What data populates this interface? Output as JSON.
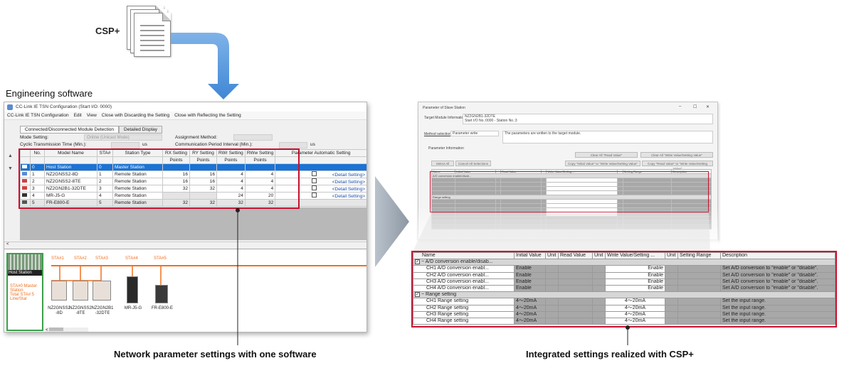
{
  "csp_label": "CSP+",
  "engineering_label": "Engineering software",
  "caption_left": "Network parameter settings with one software",
  "caption_right": "Integrated settings realized with CSP+",
  "eng_window": {
    "title": "CC-Link IE TSN Configuration (Start I/O: 0000)",
    "menu": [
      "CC-Link IE TSN Configuration",
      "Edit",
      "View",
      "Close with Discarding the Setting",
      "Close with Reflecting the Setting"
    ],
    "tabs": [
      "Connected/Disconnected Module Detection",
      "Detailed Display"
    ],
    "mode_label": "Mode Setting:",
    "mode_value": "Online (Unicast Mode)",
    "assign_label": "Assignment Method:",
    "cyclic_label": "Cyclic Transmission Time (Min.):",
    "cyclic_unit": "us",
    "comm_label": "Communication Period Interval (Min.):",
    "comm_unit": "us",
    "headers": [
      "No.",
      "Model Name",
      "STA#",
      "Station Type",
      "RX Setting",
      "RY Setting",
      "RWr Setting",
      "RWw Setting",
      "Parameter Automatic Setting"
    ],
    "subheader": "Points",
    "rows": [
      {
        "no": "0",
        "model": "Host Station",
        "sta": "0",
        "type": "Master Station",
        "rx": "",
        "ry": "",
        "rwr": "",
        "rww": "",
        "detail": ""
      },
      {
        "no": "1",
        "model": "NZ2GNSS2-8D",
        "sta": "1",
        "type": "Remote Station",
        "rx": "16",
        "ry": "16",
        "rwr": "4",
        "rww": "4",
        "detail": "<Detail Setting>"
      },
      {
        "no": "2",
        "model": "NZ2GNSS2-8TE",
        "sta": "2",
        "type": "Remote Station",
        "rx": "16",
        "ry": "16",
        "rwr": "4",
        "rww": "4",
        "detail": "<Detail Setting>"
      },
      {
        "no": "3",
        "model": "NZ2GN2B1-32DTE",
        "sta": "3",
        "type": "Remote Station",
        "rx": "32",
        "ry": "32",
        "rwr": "4",
        "rww": "4",
        "detail": "<Detail Setting>"
      },
      {
        "no": "4",
        "model": "MR-J5-G",
        "sta": "4",
        "type": "Remote Station",
        "rx": "",
        "ry": "",
        "rwr": "24",
        "rww": "20",
        "detail": "<Detail Setting>"
      },
      {
        "no": "5",
        "model": "FR-E800-E",
        "sta": "5",
        "type": "Remote Station",
        "rx": "32",
        "ry": "32",
        "rwr": "32",
        "rww": "32",
        "detail": ""
      }
    ],
    "topology": {
      "sta_labels": [
        "STA#1",
        "STA#2",
        "STA#3",
        "STA#4",
        "STA#5"
      ],
      "host_title": "Host Station",
      "host_info": [
        "STA#0  Master",
        "Station",
        "Total STA#:5",
        "Line/Star"
      ],
      "devices": [
        "NZ2GNSS2\n-8D",
        "NZ2GNSS2\n-8TE",
        "NZ2GN2B1\n-32DTE",
        "MR-J5-G",
        "FR-E800-E"
      ]
    }
  },
  "param_window": {
    "title": "Parameter of Slave Station",
    "target_label": "Target Module Information:",
    "target_value": "NZ2GN2B1-32DTE",
    "target_value2": "Start I/O No.:0000 - Station No.:3",
    "method_label": "Method selection:",
    "method_value": "Parameter write",
    "method_desc": "The parameters are written to the target module.",
    "info_label": "Parameter Information",
    "buttons": [
      "Select All",
      "Cancel All Selections",
      "Clear All \"Read Value\"",
      "Clear All \"Write Value/Setting Value\"",
      "Copy \"Initial Value\" to \"Write Value/Setting Value\"",
      "Copy \"Read Value\" to \"Write Value/Setting Value\""
    ]
  },
  "zoom_table": {
    "headers": [
      "Name",
      "Initial Value",
      "Unit",
      "Read Value",
      "Unit",
      "Write Value/Setting ...",
      "Unit",
      "Setting Range",
      "Description"
    ],
    "groups": [
      {
        "name": "A/D conversion enable/disab...",
        "rows": [
          {
            "name": "CH1 A/D conversion enabl...",
            "initial": "Enable",
            "write": "Enable",
            "desc": "Set A/D conversion to \"enable\" or \"disable\"."
          },
          {
            "name": "CH2 A/D conversion enabl...",
            "initial": "Enable",
            "write": "Enable",
            "desc": "Set A/D conversion to \"enable\" or \"disable\"."
          },
          {
            "name": "CH3 A/D conversion enabl...",
            "initial": "Enable",
            "write": "Enable",
            "desc": "Set A/D conversion to \"enable\" or \"disable\"."
          },
          {
            "name": "CH4 A/D conversion enabl...",
            "initial": "Enable",
            "write": "Enable",
            "desc": "Set A/D conversion to \"enable\" or \"disable\"."
          }
        ]
      },
      {
        "name": "Range setting",
        "rows": [
          {
            "name": "CH1 Range setting",
            "initial": "4～20mA",
            "write": "4～20mA",
            "desc": "Set the input range."
          },
          {
            "name": "CH2 Range setting",
            "initial": "4～20mA",
            "write": "4～20mA",
            "desc": "Set the input range."
          },
          {
            "name": "CH3 Range setting",
            "initial": "4～20mA",
            "write": "4～20mA",
            "desc": "Set the input range."
          },
          {
            "name": "CH4 Range setting",
            "initial": "4～20mA",
            "write": "4～20mA",
            "desc": "Set the input range."
          }
        ]
      }
    ]
  },
  "colors": {
    "accent_red": "#c8102e",
    "arrow_blue": "#4a90d9",
    "selection_blue": "#1a73d6",
    "topology_orange": "#f07020"
  }
}
